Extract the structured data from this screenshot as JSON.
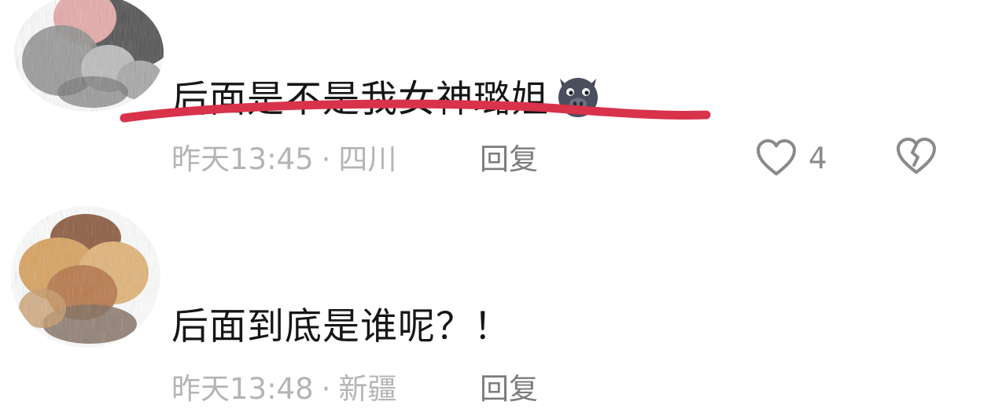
{
  "comments": [
    {
      "text": "后面是不是我女神璐姐",
      "emoji": "pig-face-emoji",
      "time": "昨天13:45",
      "separator": "·",
      "location": "四川",
      "reply_label": "回复",
      "like_count": "4",
      "highlighted": true,
      "highlight_color": "#d9324b"
    },
    {
      "text": "后面到底是谁呢？！",
      "time": "昨天13:48",
      "separator": "·",
      "location": "新疆",
      "reply_label": "回复"
    }
  ],
  "colors": {
    "text": "#161616",
    "meta": "#b4b4b4",
    "reply": "#7c7c7c",
    "icon": "#8a8a8a"
  },
  "icons": [
    "heart-outline-icon",
    "broken-heart-icon"
  ]
}
